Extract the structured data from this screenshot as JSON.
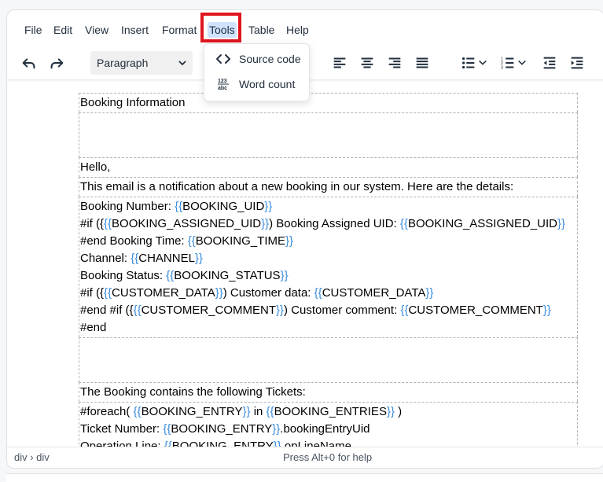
{
  "menubar": {
    "items": [
      {
        "label": "File"
      },
      {
        "label": "Edit"
      },
      {
        "label": "View"
      },
      {
        "label": "Insert"
      },
      {
        "label": "Format"
      },
      {
        "label": "Tools"
      },
      {
        "label": "Table"
      },
      {
        "label": "Help"
      }
    ]
  },
  "toolbar": {
    "block_format": "Paragraph",
    "icons": [
      "undo-icon",
      "redo-icon",
      "align-left-icon",
      "align-center-icon",
      "align-right-icon",
      "justify-icon",
      "bullet-list-icon",
      "numbered-list-icon",
      "outdent-icon",
      "indent-icon"
    ]
  },
  "tools_menu": {
    "items": [
      {
        "label": "Source code",
        "icon": "source-code-icon"
      },
      {
        "label": "Word count",
        "icon": "word-count-icon",
        "icon_text_top": "123",
        "icon_text_bottom": "abc"
      }
    ]
  },
  "content": {
    "heading": "Booking Information",
    "hello": "Hello,",
    "intro": "This email is a notification about a new booking in our system. Here are the details:",
    "details": [
      [
        "Booking Number: ",
        "{{",
        "BOOKING_UID",
        "}}"
      ],
      [
        "#if ({",
        "{{",
        "BOOKING_ASSIGNED_UID",
        "}}",
        ") Booking Assigned UID: ",
        "{{",
        "BOOKING_ASSIGNED_UID",
        "}}"
      ],
      [
        "#end Booking Time: ",
        "{{",
        "BOOKING_TIME",
        "}}"
      ],
      [
        "Channel: ",
        "{{",
        "CHANNEL",
        "}}"
      ],
      [
        "Booking Status: ",
        "{{",
        "BOOKING_STATUS",
        "}}"
      ],
      [
        "#if ({",
        "{{",
        "CUSTOMER_DATA",
        "}}",
        ") Customer data: ",
        "{{",
        "CUSTOMER_DATA",
        "}}"
      ],
      [
        "#end #if ({",
        "{{",
        "CUSTOMER_COMMENT",
        "}}",
        ") Customer comment: ",
        "{{",
        "CUSTOMER_COMMENT",
        "}}"
      ],
      [
        "#end"
      ]
    ],
    "tickets_intro": "The Booking contains the following Tickets:",
    "foreach": [
      [
        "#foreach( ",
        "{{",
        "BOOKING_ENTRY",
        "}}",
        " in ",
        "{{",
        "BOOKING_ENTRIES",
        "}}",
        " )"
      ],
      [
        "Ticket Number: ",
        "{{",
        "BOOKING_ENTRY",
        "}}",
        ".bookingEntryUid"
      ],
      [
        "Operation Line: ",
        "{{",
        "BOOKING_ENTRY",
        "}}",
        ".opLineName"
      ]
    ]
  },
  "statusbar": {
    "path": "div › div",
    "help": "Press Alt+0 for help"
  }
}
